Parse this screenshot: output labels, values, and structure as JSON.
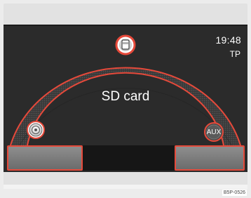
{
  "status": {
    "clock": "19:48",
    "tp": "TP"
  },
  "source": {
    "title": "SD card"
  },
  "icons": {
    "top": "sd-card-icon",
    "left": "cd-disc-icon",
    "right": "aux-icon"
  },
  "aux": {
    "label": "AUX"
  },
  "figure_code": "B5P-0526",
  "colors": {
    "accent": "#e6493a",
    "background": "#2b2b2b",
    "text": "#ffffff"
  }
}
